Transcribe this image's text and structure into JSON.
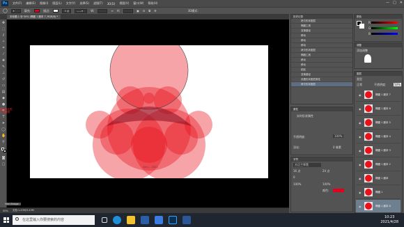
{
  "app": {
    "logo": "Ps",
    "window_controls": [
      "—",
      "□",
      "✕"
    ]
  },
  "menus": [
    "文件(F)",
    "编辑(E)",
    "图像(I)",
    "图层(L)",
    "文字(Y)",
    "选择(S)",
    "滤镜(T)",
    "3D(D)",
    "视图(V)",
    "窗口(W)",
    "帮助(H)"
  ],
  "options": {
    "label_fill": "填充:",
    "label_stroke": "描边:",
    "stroke_size": "3 点",
    "width_label": "W:",
    "height_label": "H:",
    "mode_label": "3D模式:"
  },
  "document": {
    "tab_title": "未标题-1 @ 50% (椭圆 1 副本 7, RGB/8) *",
    "canvas_caption": "Qin J... 2021"
  },
  "tool_note": "颜色对比的工具要领",
  "status": {
    "zoom": "50%",
    "doc_info": "文档:1.43M/3.43M",
    "tab": "Mini Bridge"
  },
  "history": {
    "title": "历史记录",
    "items": [
      "拷贝形状图层",
      "椭圆工具",
      "变换路径",
      "移动",
      "移动",
      "移动",
      "拷贝形状图层",
      "椭圆工具",
      "移动",
      "移动",
      "粘贴",
      "变换路径",
      "设置形状图层属性",
      "拷贝形状图层"
    ],
    "selected_index": 13
  },
  "color": {
    "title": "颜色",
    "r": "R",
    "g": "G",
    "b": "B"
  },
  "adjust": {
    "title": "调整",
    "add_label": "添加调整"
  },
  "properties": {
    "title": "属性",
    "label": "实时形状属性",
    "opacity": "不透明度:",
    "opacity_value": "100%",
    "feather": "羽化:",
    "feather_value": "0 像素",
    "w_value": "112 像素",
    "h_value": "112 像素",
    "x_value": "214 像素",
    "y_value": "58 像素"
  },
  "character": {
    "title": "字符",
    "font": "方正兰亭黑",
    "size": "16 点",
    "leading": "24 点",
    "tracking": "0",
    "scale_h": "100%",
    "scale_v": "100%",
    "color_label": "颜色:"
  },
  "layers": {
    "title": "图层",
    "kind_label": "类型",
    "mode_label": "正常",
    "opacity_label": "不透明度:",
    "opacity_value": "50%",
    "items": [
      "椭圆 1 副本 7",
      "椭圆 1 副本 6",
      "椭圆 1 副本 5",
      "椭圆 1 副本 4",
      "椭圆 1 副本 3",
      "椭圆 1 副本 2",
      "椭圆 1 副本",
      "椭圆 1",
      "椭圆 1 副本 8"
    ]
  },
  "taskbar": {
    "search_placeholder": "在这里输入你要搜索的内容",
    "time": "10:23",
    "date": "2021/4/28"
  }
}
